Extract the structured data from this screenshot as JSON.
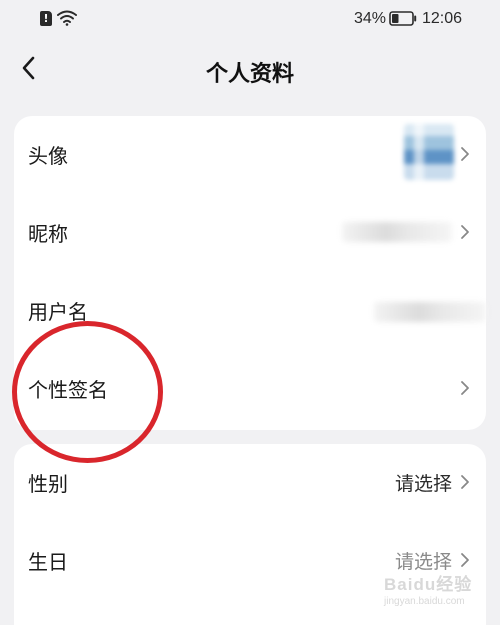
{
  "status_bar": {
    "sim_icon": "sim-alert-icon",
    "wifi_icon": "wifi-icon",
    "battery_percent": "34%",
    "battery_icon": "battery-icon",
    "battery_level": 0.34,
    "time": "12:06"
  },
  "header": {
    "back_icon": "back-arrow-icon",
    "title": "个人资料"
  },
  "profile_card": {
    "rows": [
      {
        "label": "头像",
        "value": "",
        "icon": "chevron-right-icon"
      },
      {
        "label": "昵称",
        "value": "",
        "icon": "chevron-right-icon"
      },
      {
        "label": "用户名",
        "value": ""
      },
      {
        "label": "个性签名",
        "value": "",
        "icon": "chevron-right-icon"
      }
    ]
  },
  "info_card": {
    "rows": [
      {
        "label": "性别",
        "value": "请选择",
        "icon": "chevron-right-icon"
      },
      {
        "label": "生日",
        "value": "请选择",
        "icon": "chevron-right-icon"
      }
    ]
  },
  "watermark": {
    "text": "Baidu经验",
    "sub": "jingyan.baidu.com"
  },
  "colors": {
    "background": "#f1f1f3",
    "card": "#ffffff",
    "annotation": "#d9262c",
    "muted_text": "#8a8a8a"
  }
}
